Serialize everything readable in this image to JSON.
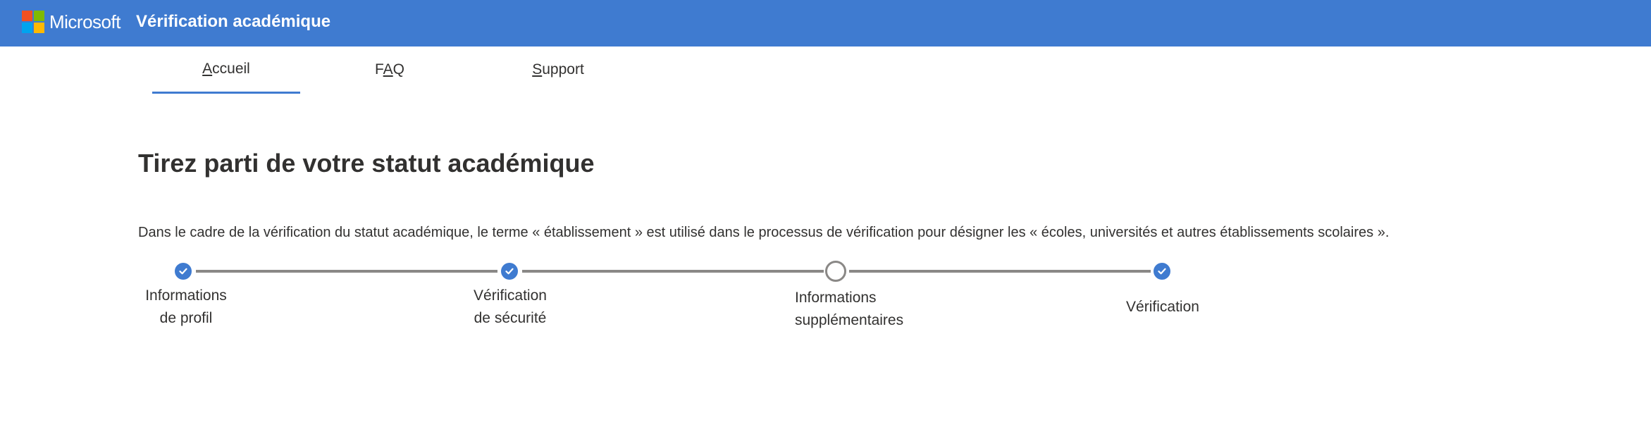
{
  "header": {
    "brand": "Microsoft",
    "title": "Vérification académique",
    "logo_colors": [
      "#f25022",
      "#7fba00",
      "#00a4ef",
      "#ffb900"
    ]
  },
  "nav": {
    "tabs": [
      {
        "mnemonic": "A",
        "rest": "ccueil",
        "active": true
      },
      {
        "prefix": "F",
        "mnemonic": "A",
        "rest": "Q",
        "active": false
      },
      {
        "mnemonic": "S",
        "rest": "upport",
        "active": false
      }
    ]
  },
  "main": {
    "title": "Tirez parti de votre statut académique",
    "description": "Dans le cadre de la vérification du statut académique, le terme « établissement » est utilisé dans le processus de vérification pour désigner les « écoles, universités et autres établissements scolaires »."
  },
  "steps": [
    {
      "line1": "Informations",
      "line2": "de profil",
      "state": "done"
    },
    {
      "line1": "Vérification",
      "line2": "de sécurité",
      "state": "done"
    },
    {
      "line1": "Informations",
      "line2": "supplémentaires",
      "state": "pending"
    },
    {
      "line1": "Vérification",
      "line2": "",
      "state": "done"
    }
  ],
  "colors": {
    "accent": "#3f7bd0",
    "line": "#8a8886"
  }
}
